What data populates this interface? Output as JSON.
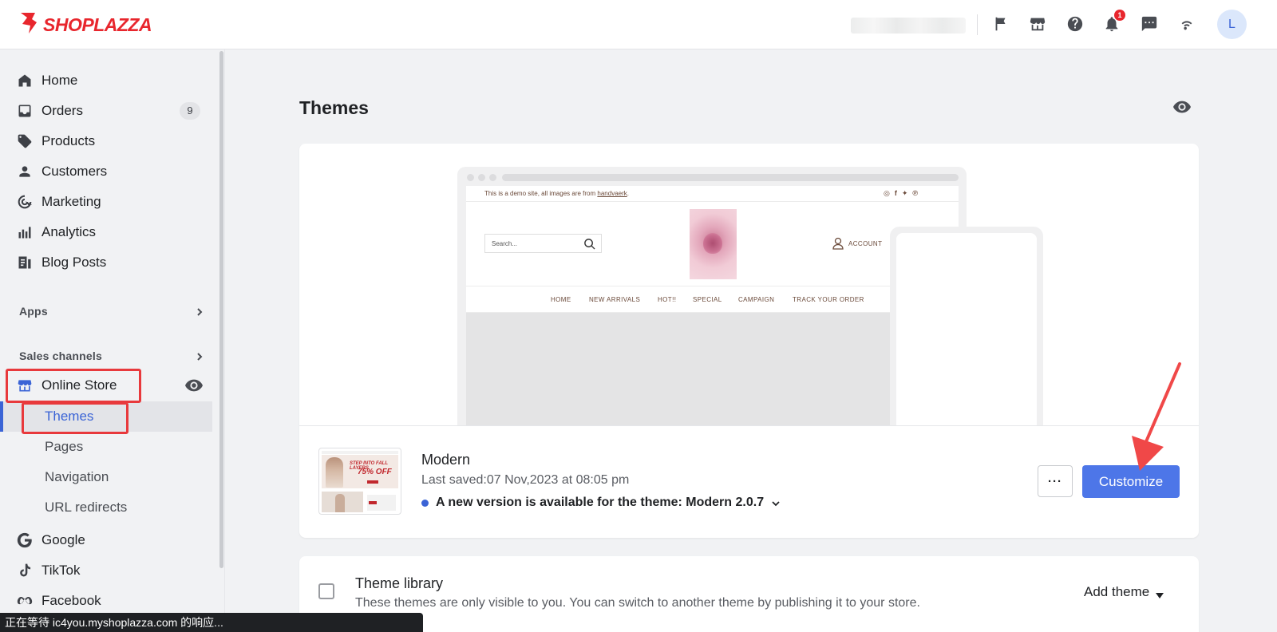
{
  "brand": {
    "name": "SHOPLAZZA",
    "color": "#e8262d"
  },
  "header": {
    "icons": [
      "flag-icon",
      "store-icon",
      "help-icon",
      "bell-icon",
      "chat-icon",
      "wifi-icon"
    ],
    "notification_count": "1",
    "avatar_initial": "L"
  },
  "sidebar": {
    "items": [
      {
        "label": "Home",
        "icon": "home-icon"
      },
      {
        "label": "Orders",
        "icon": "inbox-icon",
        "count": "9"
      },
      {
        "label": "Products",
        "icon": "tag-icon"
      },
      {
        "label": "Customers",
        "icon": "person-icon"
      },
      {
        "label": "Marketing",
        "icon": "target-icon"
      },
      {
        "label": "Analytics",
        "icon": "bar-chart-icon"
      },
      {
        "label": "Blog Posts",
        "icon": "document-icon"
      }
    ],
    "apps_label": "Apps",
    "sales_channels_label": "Sales channels",
    "online_store": {
      "label": "Online Store",
      "sub_items": [
        "Themes",
        "Pages",
        "Navigation",
        "URL redirects"
      ]
    },
    "channels": [
      {
        "label": "Google",
        "icon": "google-icon"
      },
      {
        "label": "TikTok",
        "icon": "tiktok-icon"
      },
      {
        "label": "Facebook",
        "icon": "meta-icon"
      }
    ]
  },
  "status_bar": "正在等待 ic4you.myshoplazza.com 的响应...",
  "main": {
    "title": "Themes",
    "preview": {
      "demo_note_prefix": "This is a demo site, all images are from ",
      "demo_note_link": "handvaerk",
      "demo_note_suffix": ".",
      "search_placeholder": "Search...",
      "account_label": "ACCOUNT",
      "nav": [
        "HOME",
        "NEW ARRIVALS",
        "HOT!!",
        "SPECIAL",
        "CAMPAIGN",
        "TRACK YOUR ORDER"
      ]
    },
    "theme": {
      "name": "Modern",
      "last_saved": "Last saved:07 Nov,2023 at 08:05 pm",
      "update_notice": "A new version is available for the theme: Modern 2.0.7",
      "thumb_text_small": "STEP INTO FALL LAYERS",
      "thumb_text_big": "75% OFF",
      "more_label": "···",
      "customize_label": "Customize"
    },
    "library": {
      "title": "Theme library",
      "description": "These themes are only visible to you. You can switch to another theme by publishing it to your store.",
      "add_theme_label": "Add theme"
    }
  },
  "colors": {
    "accent": "#4d76e8",
    "highlight": "#e8393c",
    "annotation_arrow": "#f04848"
  }
}
